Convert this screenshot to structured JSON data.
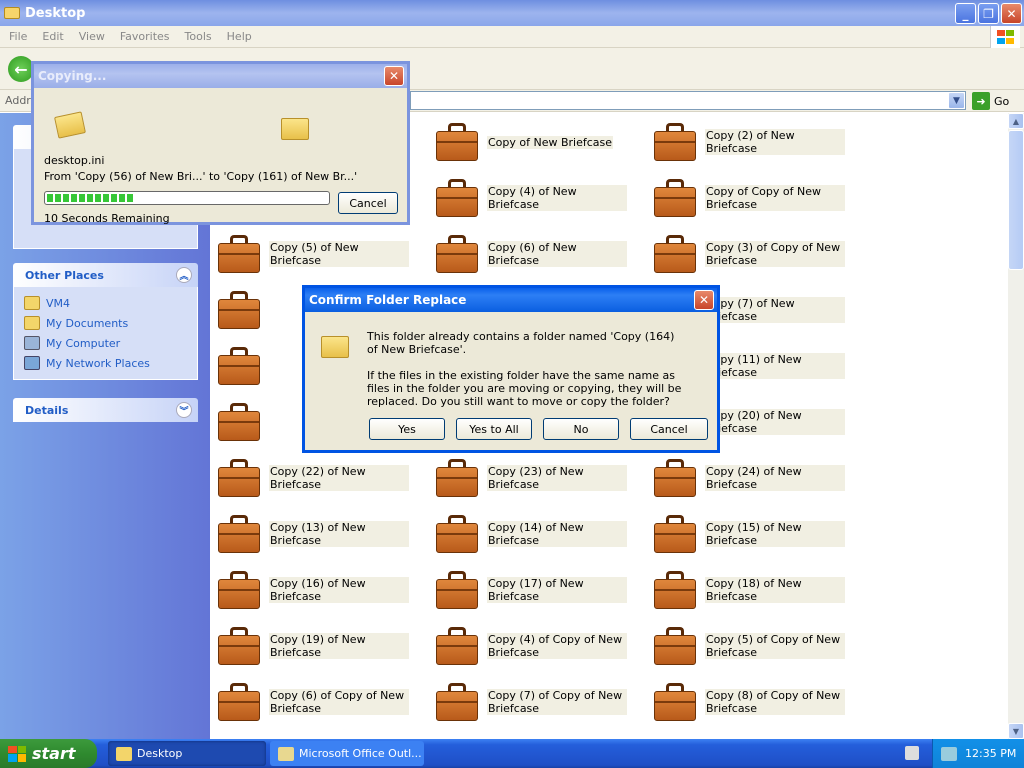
{
  "window": {
    "title": "Desktop"
  },
  "menu": [
    "File",
    "Edit",
    "View",
    "Favorites",
    "Tools",
    "Help"
  ],
  "address": {
    "label": "Address",
    "go": "Go"
  },
  "left_pane": {
    "other_places": {
      "title": "Other Places",
      "items": [
        "VM4",
        "My Documents",
        "My Computer",
        "My Network Places"
      ]
    },
    "details": {
      "title": "Details"
    }
  },
  "files": [
    "Copy of New Briefcase",
    "Copy (2) of New Briefcase",
    "Copy (4) of New Briefcase",
    "Copy of Copy of New Briefcase",
    "Copy (5) of New Briefcase",
    "Copy (6) of New Briefcase",
    "Copy (3) of Copy of New Briefcase",
    "Copy (7) of New Briefcase",
    "Copy (11) of New Briefcase",
    "Copy (20) of New Briefcase",
    "Copy (22) of New Briefcase",
    "Copy (23) of New Briefcase",
    "Copy (24) of New Briefcase",
    "Copy (13) of New Briefcase",
    "Copy (14) of New Briefcase",
    "Copy (15) of New Briefcase",
    "Copy (16) of New Briefcase",
    "Copy (17) of New Briefcase",
    "Copy (18) of New Briefcase",
    "Copy (19) of New Briefcase",
    "Copy (4) of Copy of New Briefcase",
    "Copy (5) of Copy of New Briefcase",
    "Copy (6) of Copy of New Briefcase",
    "Copy (7) of Copy of New Briefcase",
    "Copy (8) of Copy of New Briefcase"
  ],
  "copy_dialog": {
    "title": "Copying...",
    "filename": "desktop.ini",
    "from_to": "From 'Copy (56) of New Bri...' to 'Copy (161) of New Br...'",
    "remaining": "10 Seconds Remaining",
    "cancel": "Cancel",
    "progress_blocks": 11
  },
  "confirm_dialog": {
    "title": "Confirm Folder Replace",
    "message1": "This folder already contains a folder named 'Copy (164) of New Briefcase'.",
    "message2": "If the files in the existing folder have the same name as files in the folder you are moving or copying, they will be replaced.  Do you still want to move or copy the folder?",
    "buttons": {
      "yes": "Yes",
      "yes_to_all": "Yes to All",
      "no": "No",
      "cancel": "Cancel"
    }
  },
  "taskbar": {
    "start": "start",
    "items": [
      "Desktop",
      "Microsoft Office Outl..."
    ],
    "clock": "12:35 PM"
  },
  "colors": {
    "xp_blue": "#0054e3",
    "task_pane": "#6375d6",
    "taskbar": "#245edb",
    "start_green": "#2f8a2f"
  }
}
